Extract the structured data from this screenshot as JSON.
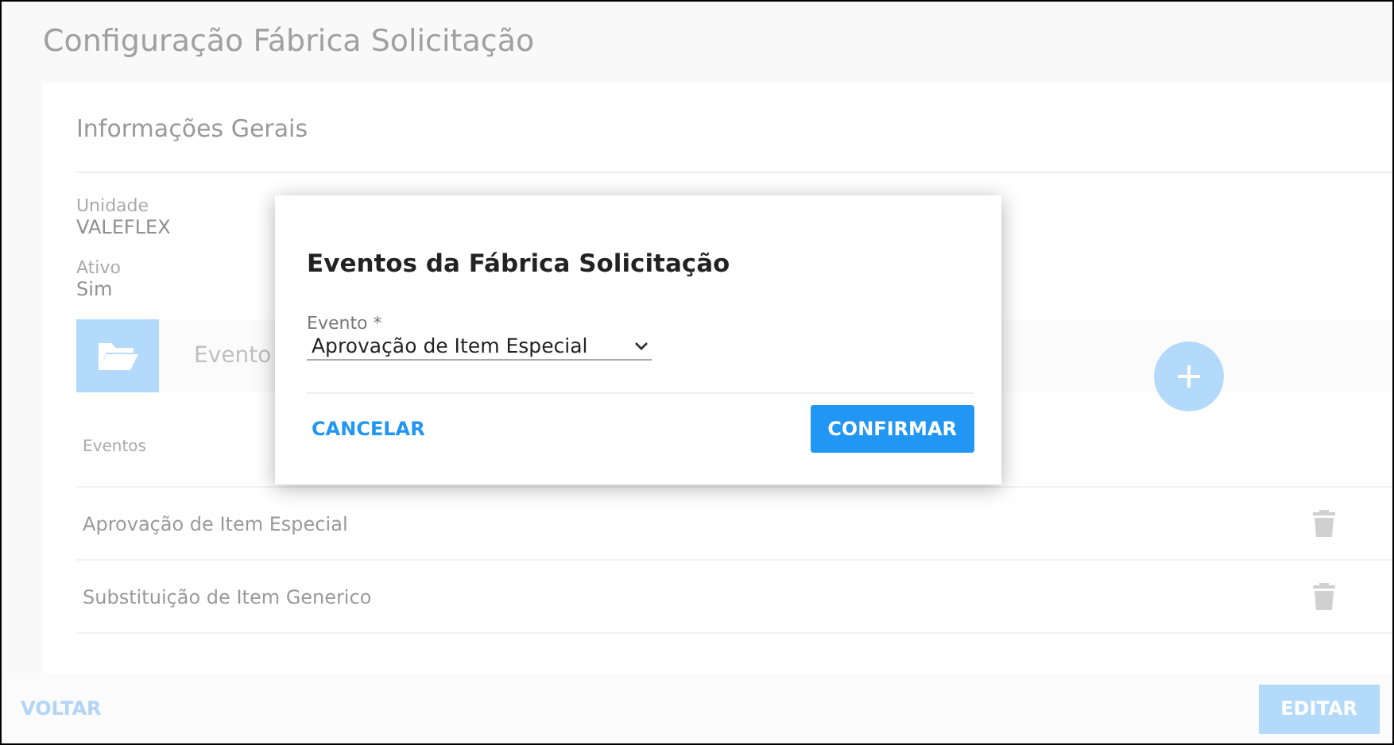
{
  "page": {
    "title": "Configuração Fábrica Solicitação"
  },
  "general_info": {
    "heading": "Informações Gerais",
    "fields": [
      {
        "label": "Unidade",
        "value": "VALEFLEX"
      },
      {
        "label": "Ativo",
        "value": "Sim"
      }
    ]
  },
  "events_section": {
    "heading": "Evento"
  },
  "events_table": {
    "columns": [
      "Eventos"
    ],
    "rows": [
      {
        "name": "Aprovação de Item Especial"
      },
      {
        "name": "Substituição de Item Generico"
      }
    ]
  },
  "footer": {
    "back": "VOLTAR",
    "edit": "EDITAR",
    "edit_disabled": true
  },
  "dialog": {
    "title": "Eventos da Fábrica Solicitação",
    "field": {
      "label": "Evento *",
      "value": "Aprovação de Item Especial"
    },
    "cancel": "CANCELAR",
    "confirm": "CONFIRMAR"
  }
}
